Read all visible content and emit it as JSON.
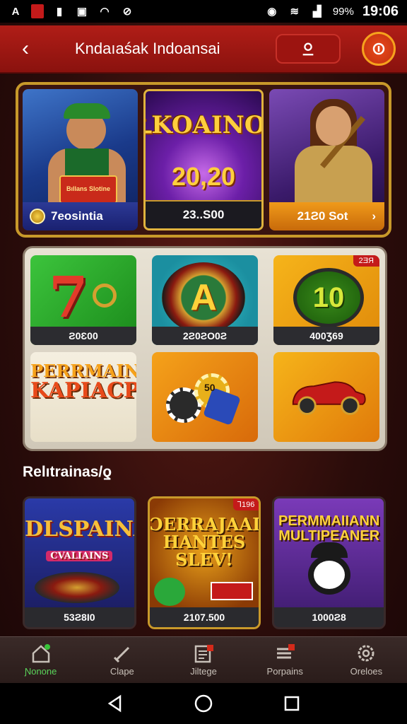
{
  "status_bar": {
    "battery_pct": "99%",
    "time": "19:06"
  },
  "header": {
    "title": "Kndaıaśak Indoansai"
  },
  "featured": {
    "title": "ꝈKOAINOƍ",
    "number": "20,20",
    "cards": [
      {
        "label": "7eosintiа",
        "sign": "Bıllans Slotine"
      },
      {
        "label": "23..S00"
      },
      {
        "label": "21Ƨ0 Sot"
      }
    ]
  },
  "grid": {
    "badge": "2ƎЯ",
    "tiles": [
      {
        "label": "Ƨ0Ɛ00"
      },
      {
        "label": "2Ƨ0ƧO0Ƨ",
        "letter": "A"
      },
      {
        "label": "400Ʒ69",
        "letter": "10"
      },
      {
        "promo_1": "PERRMAINA",
        "promo_2": "KAPIACP"
      },
      {
        "chip_text": "50"
      },
      {}
    ]
  },
  "section": {
    "title": "Relıtrainas/ƍ"
  },
  "bottom_cards": [
    {
      "title": "DLSPAINA",
      "sub": "CVALIAINS",
      "label": "53Ƨ8I0"
    },
    {
      "title_1": "ƆERRАJAAIG",
      "title_2": "HANTES",
      "title_3": "SLEV!",
      "badge": "Ꞁ196",
      "label": "2107.500"
    },
    {
      "title_1": "PERMMAIIANN",
      "title_2": "MULTIPEANER",
      "label": "1000Ƨ8"
    }
  ],
  "nav": [
    {
      "label": "Ɲonone",
      "icon": "home-icon"
    },
    {
      "label": "Clape",
      "icon": "sword-icon"
    },
    {
      "label": "Jiltege",
      "icon": "list-icon"
    },
    {
      "label": "Porpains",
      "icon": "menu-icon"
    },
    {
      "label": "Oreloes",
      "icon": "settings-icon"
    }
  ]
}
